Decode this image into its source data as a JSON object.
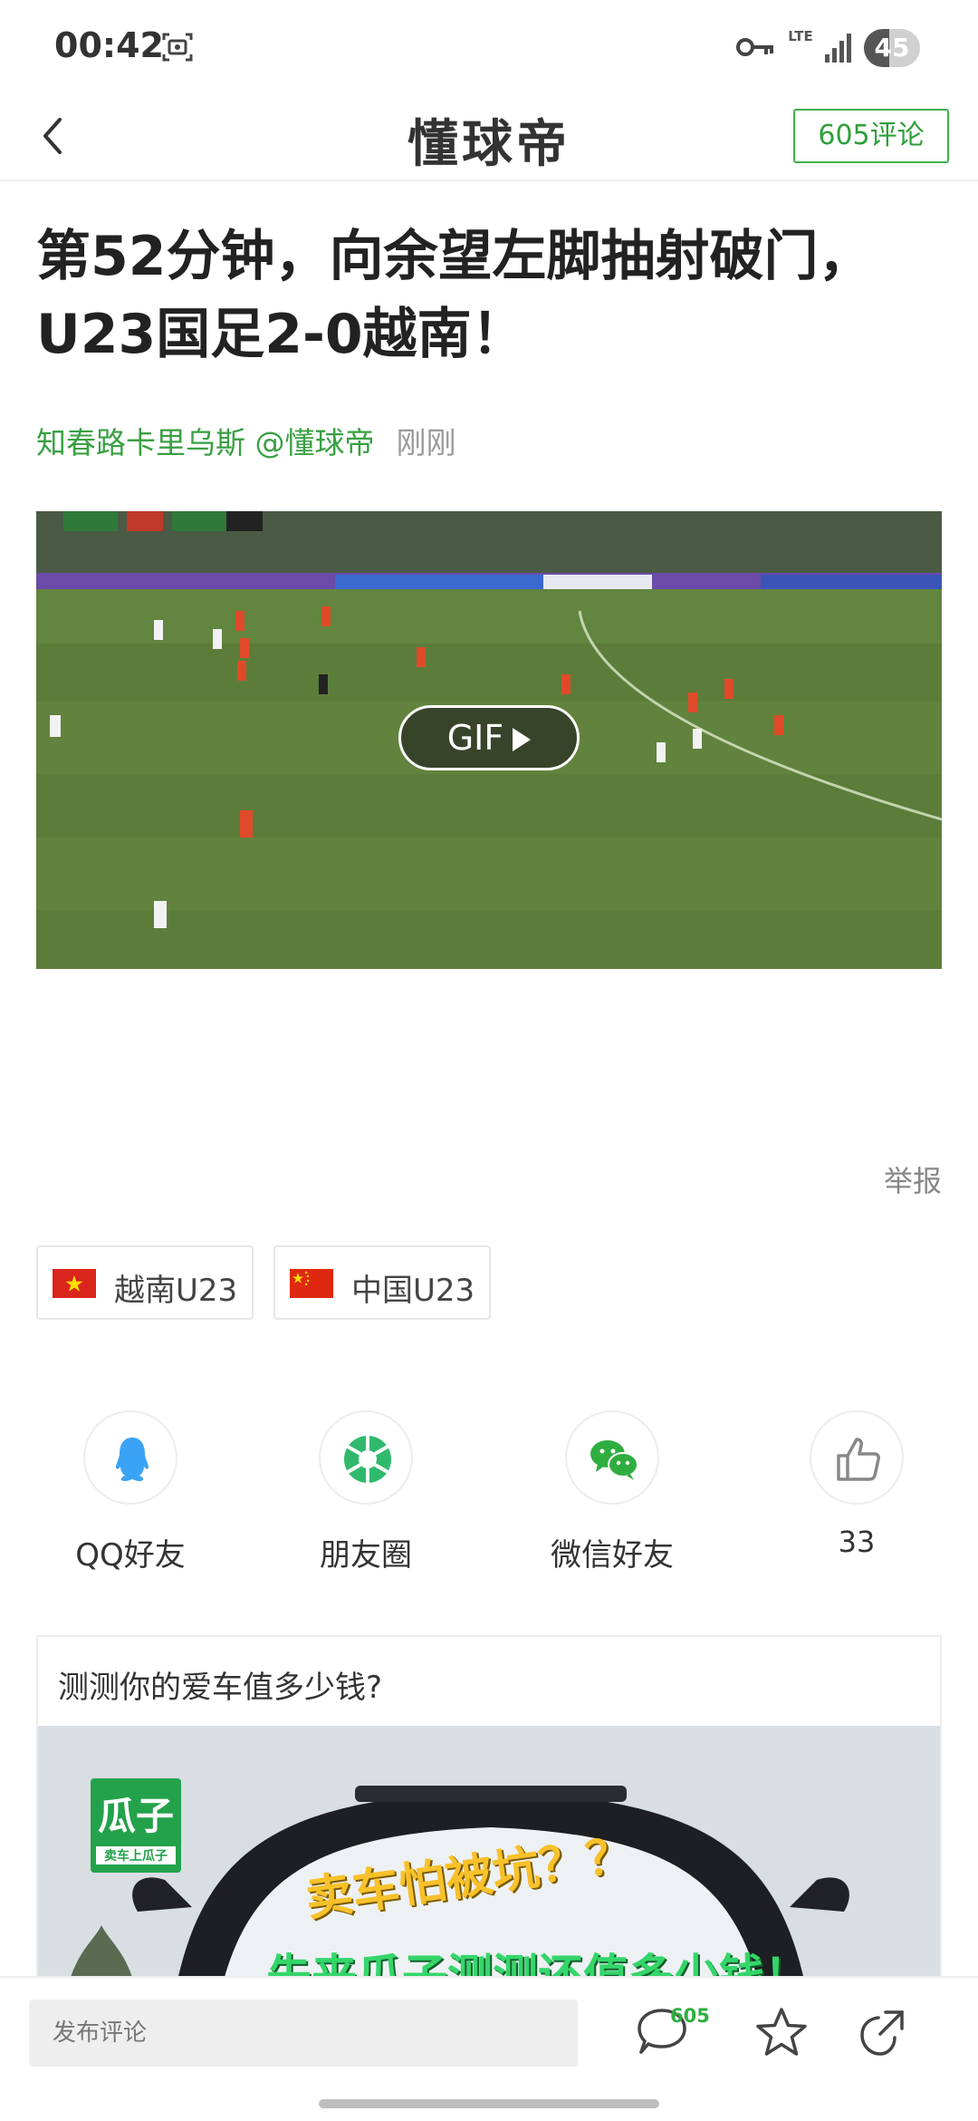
{
  "status_bar": {
    "time": "00:42",
    "network": "LTE",
    "battery": "45",
    "battery_level_percent": 45
  },
  "header": {
    "brand": "懂球帝",
    "comment_button": "605评论"
  },
  "article": {
    "title_line1": "第52分钟，向余望左脚抽射破门，",
    "title_line2": "U23国足2-0越南！",
    "author": "知春路卡里乌斯 @懂球帝",
    "time": "刚刚",
    "gif_label": "GIF",
    "report": "举报"
  },
  "tags": [
    {
      "label": "越南U23",
      "flag_icon": "vietnam-flag-icon"
    },
    {
      "label": "中国U23",
      "flag_icon": "china-flag-icon"
    }
  ],
  "share": [
    {
      "label": "QQ好友",
      "icon": "qq-icon"
    },
    {
      "label": "朋友圈",
      "icon": "moments-icon"
    },
    {
      "label": "微信好友",
      "icon": "wechat-icon"
    },
    {
      "label": "33",
      "icon": "thumbs-up-icon"
    }
  ],
  "ad": {
    "title": "测测你的爱车值多少钱?",
    "logo_big": "瓜子",
    "logo_small": "卖车上瓜子",
    "headline1": "卖车怕被坑？？",
    "headline2": "先来瓜子测测还值多少钱！"
  },
  "bottom_bar": {
    "comment_placeholder": "发布评论",
    "comment_count": "605"
  },
  "colors": {
    "accent_green": "#3aa043",
    "text_dark": "#222222",
    "text_muted": "#999999"
  }
}
